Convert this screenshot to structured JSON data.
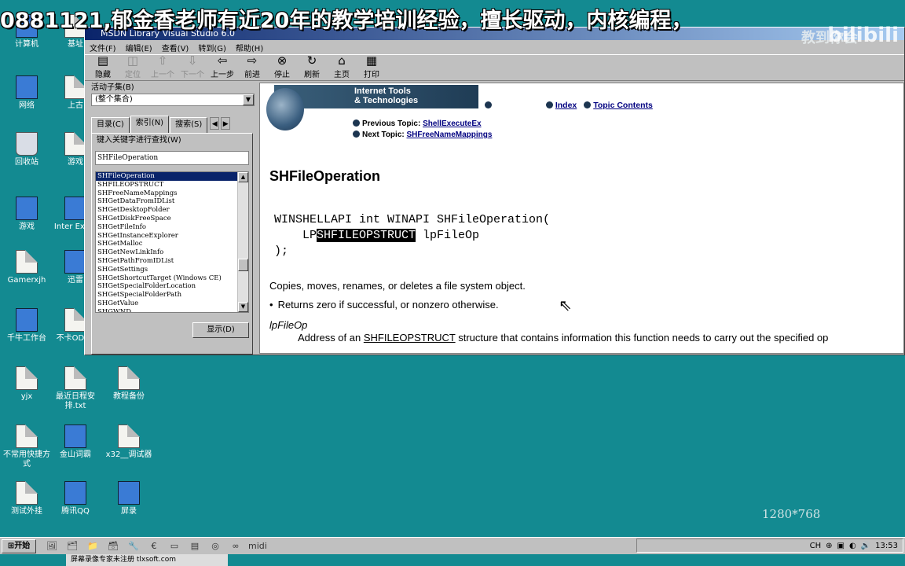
{
  "banner": {
    "text": "0881121,郁金香老师有近20年的教学培训经验，擅长驱动，内核编程，",
    "watermark": "教到你会",
    "logo": "bilibili"
  },
  "desktop_icons": [
    {
      "label": "计算机",
      "kind": "sys"
    },
    {
      "label": "基址",
      "kind": "doc"
    },
    {
      "label": "网络",
      "kind": "sys"
    },
    {
      "label": "上古",
      "kind": "doc"
    },
    {
      "label": "回收站",
      "kind": "trash"
    },
    {
      "label": "游戏",
      "kind": "doc"
    },
    {
      "label": "游戏",
      "kind": "sys"
    },
    {
      "label": "Inter Explo",
      "kind": "sys"
    },
    {
      "label": "Gamerxjh",
      "kind": "doc"
    },
    {
      "label": "迅雷",
      "kind": "sys"
    },
    {
      "label": "千牛工作台",
      "kind": "sys"
    },
    {
      "label": "不卡OD 新",
      "kind": "doc"
    },
    {
      "label": "yjx",
      "kind": "doc"
    },
    {
      "label": "最近日程安排.txt",
      "kind": "doc"
    },
    {
      "label": "教程备份",
      "kind": "doc"
    },
    {
      "label": "不常用快捷方式",
      "kind": "doc"
    },
    {
      "label": "金山词霸",
      "kind": "sys"
    },
    {
      "label": "x32__调试器",
      "kind": "doc"
    },
    {
      "label": "测试外挂",
      "kind": "doc"
    },
    {
      "label": "腾讯QQ",
      "kind": "sys"
    },
    {
      "label": "屏录",
      "kind": "sys"
    }
  ],
  "window": {
    "title": "MSDN Library Visual Studio 6.0",
    "menu": [
      "文件(F)",
      "编辑(E)",
      "查看(V)",
      "转到(G)",
      "帮助(H)"
    ],
    "toolbar": [
      {
        "label": "隐藏",
        "icon": "hide-icon",
        "enabled": true
      },
      {
        "label": "定位",
        "icon": "locate-icon",
        "enabled": false
      },
      {
        "label": "上一个",
        "icon": "up-icon",
        "enabled": false
      },
      {
        "label": "下一个",
        "icon": "down-icon",
        "enabled": false
      },
      {
        "label": "上一步",
        "icon": "back-icon",
        "enabled": true
      },
      {
        "label": "前进",
        "icon": "forward-icon",
        "enabled": true
      },
      {
        "label": "停止",
        "icon": "stop-icon",
        "enabled": true
      },
      {
        "label": "刷新",
        "icon": "refresh-icon",
        "enabled": true
      },
      {
        "label": "主页",
        "icon": "home-icon",
        "enabled": true
      },
      {
        "label": "打印",
        "icon": "print-icon",
        "enabled": true
      }
    ],
    "subset_label": "活动子集(B)",
    "subset_value": "(整个集合)",
    "tabs": [
      "目录(C)",
      "索引(N)",
      "搜索(S)"
    ],
    "keyword_label": "键入关键字进行查找(W)",
    "search_value": "SHFileOperation",
    "index_items": [
      "SHFileOperation",
      "SHFILEOPSTRUCT",
      "SHFreeNameMappings",
      "SHGetDataFromIDList",
      "SHGetDesktopFolder",
      "SHGetDiskFreeSpace",
      "SHGetFileInfo",
      "SHGetInstanceExplorer",
      "SHGetMalloc",
      "SHGetNewLinkInfo",
      "SHGetPathFromIDList",
      "SHGetSettings",
      "SHGetShortcutTarget (Windows CE)",
      "SHGetSpecialFolderLocation",
      "SHGetSpecialFolderPath",
      "SHGetValue",
      "SHGWND"
    ],
    "show_button": "显示(D)"
  },
  "doc": {
    "header_title": "Internet Tools\n& Technologies",
    "index_link": "Index",
    "contents_link": "Topic Contents",
    "prev_label": "Previous Topic:",
    "prev_link": "ShellExecuteEx",
    "next_label": "Next Topic:",
    "next_link": "SHFreeNameMappings",
    "title": "SHFileOperation",
    "code_line1": "WINSHELLAPI int WINAPI SHFileOperation(",
    "code_line2_pre": "    LP",
    "code_line2_hl": "SHFILEOPSTRUCT",
    "code_line2_post": " lpFileOp",
    "code_line3": ");",
    "desc": "Copies, moves, renames, or deletes a file system object.",
    "bullet": "Returns zero if successful, or nonzero otherwise.",
    "param": "lpFileOp",
    "param_desc_pre": "Address of an ",
    "param_desc_link": "SHFILEOPSTRUCT",
    "param_desc_post": " structure that contains information this function needs to carry out the specified op"
  },
  "overlay": {
    "resolution": "1280*768"
  },
  "taskbar": {
    "start": "开始",
    "quicklaunch": [
      "🖼",
      "🗂",
      "📁",
      "🗃",
      "🔧",
      "€",
      "▭",
      "▤",
      "◎",
      "∞",
      "midi"
    ],
    "tray_text": "CH",
    "clock": "13:53",
    "recorder": "屏幕录像专家未注册 tlxsoft.com"
  }
}
